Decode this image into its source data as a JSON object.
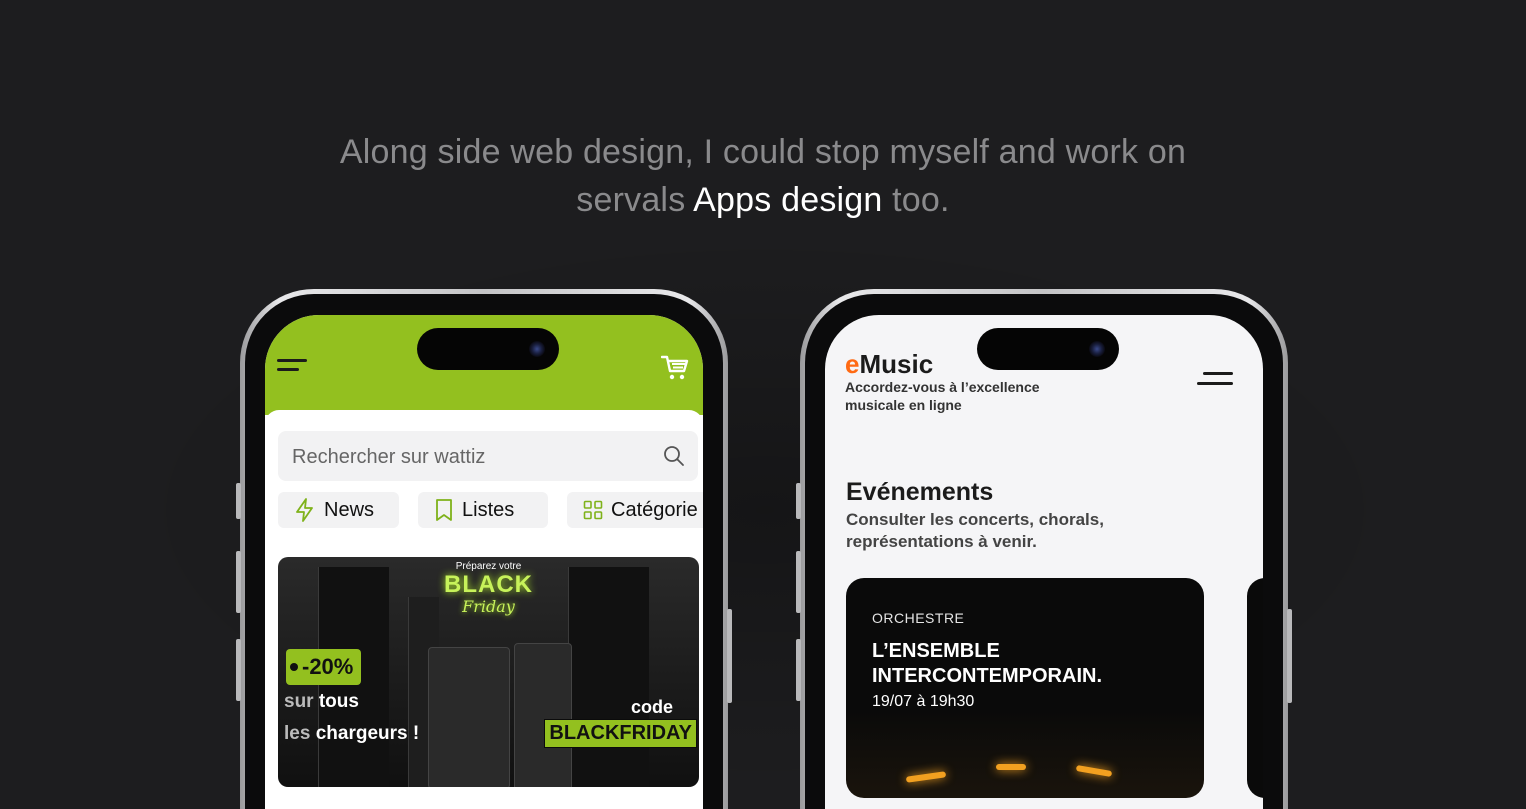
{
  "headline": {
    "line1": "Along side web design, I could stop myself and work on",
    "line2_prefix": "servals ",
    "line2_highlight": "Apps design",
    "line2_suffix": " too."
  },
  "wattiz": {
    "search_placeholder": "Rechercher sur wattiz",
    "chips": [
      {
        "label": "News",
        "icon": "bolt-icon"
      },
      {
        "label": "Listes",
        "icon": "bookmark-icon"
      },
      {
        "label": "Catégorie",
        "icon": "grid-icon"
      }
    ],
    "banner": {
      "prep": "Préparez votre",
      "title": "BLACK",
      "title2": "Friday",
      "discount": "-20%",
      "line1_a": "sur ",
      "line1_b": "tous",
      "line2_a": "les ",
      "line2_b": "chargeurs !",
      "code_label": "code",
      "code_value": "BLACKFRIDAY"
    },
    "colors": {
      "brand": "#93c01f"
    }
  },
  "emusic": {
    "logo_e": "e",
    "logo_rest": "Music",
    "tagline": "Accordez-vous à l’excellence musicale en ligne",
    "section_title": "Evénements",
    "section_sub": "Consulter les concerts, chorals, représentations à venir.",
    "card": {
      "category": "ORCHESTRE",
      "name": "L’ENSEMBLE INTERCONTEMPORAIN.",
      "date": "19/07 à 19h30"
    },
    "colors": {
      "accent": "#ff6a13"
    }
  }
}
